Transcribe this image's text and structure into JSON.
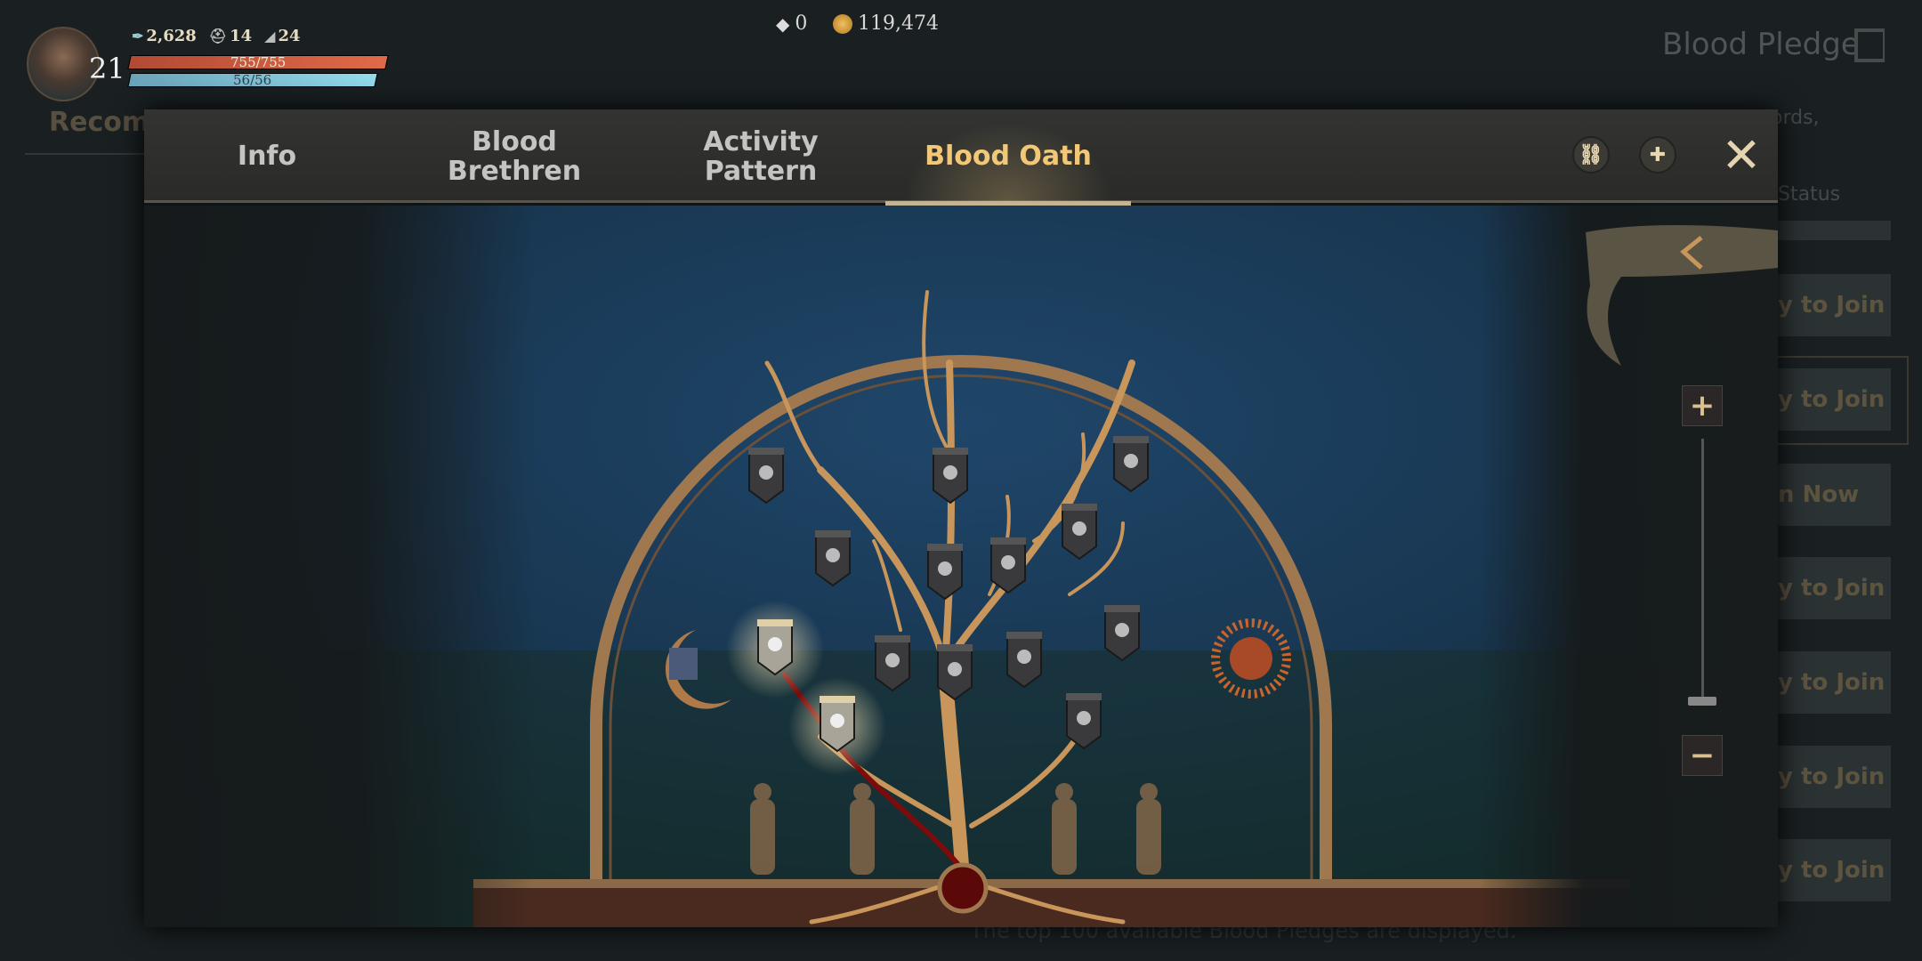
{
  "player": {
    "level": "21",
    "power": "2,628",
    "helm": "14",
    "boots": "24",
    "hp": "755/755",
    "hp_fraction": 1,
    "mp": "56/56",
    "mp_fraction": 1
  },
  "currency": {
    "diamonds": "0",
    "gold": "119,474"
  },
  "background": {
    "title": "Blood Pledge",
    "tab_partial": "Recomm",
    "words_partial": "ords,",
    "status_partial": "Status",
    "buttons": [
      "y to Join",
      "y to Join",
      "n Now",
      "y to Join",
      "y to Join",
      "y to Join",
      "y to Join"
    ],
    "note": "The top 100 available Blood Pledges are displayed."
  },
  "modal": {
    "tabs": [
      {
        "label": "Info"
      },
      {
        "label": "Blood\nBrethren"
      },
      {
        "label": "Activity\nPattern"
      },
      {
        "label": "Blood Oath",
        "active": true
      }
    ],
    "zoom_level": 0,
    "icons": [
      "link-icon",
      "chat-add-icon",
      "close-icon"
    ]
  },
  "colors": {
    "active_tab": "#f2c878",
    "hp": "#e06a48",
    "mp": "#94dcee",
    "wall": "#1d3a55",
    "tree": "#c8955a",
    "blood": "#7a0c0c"
  }
}
